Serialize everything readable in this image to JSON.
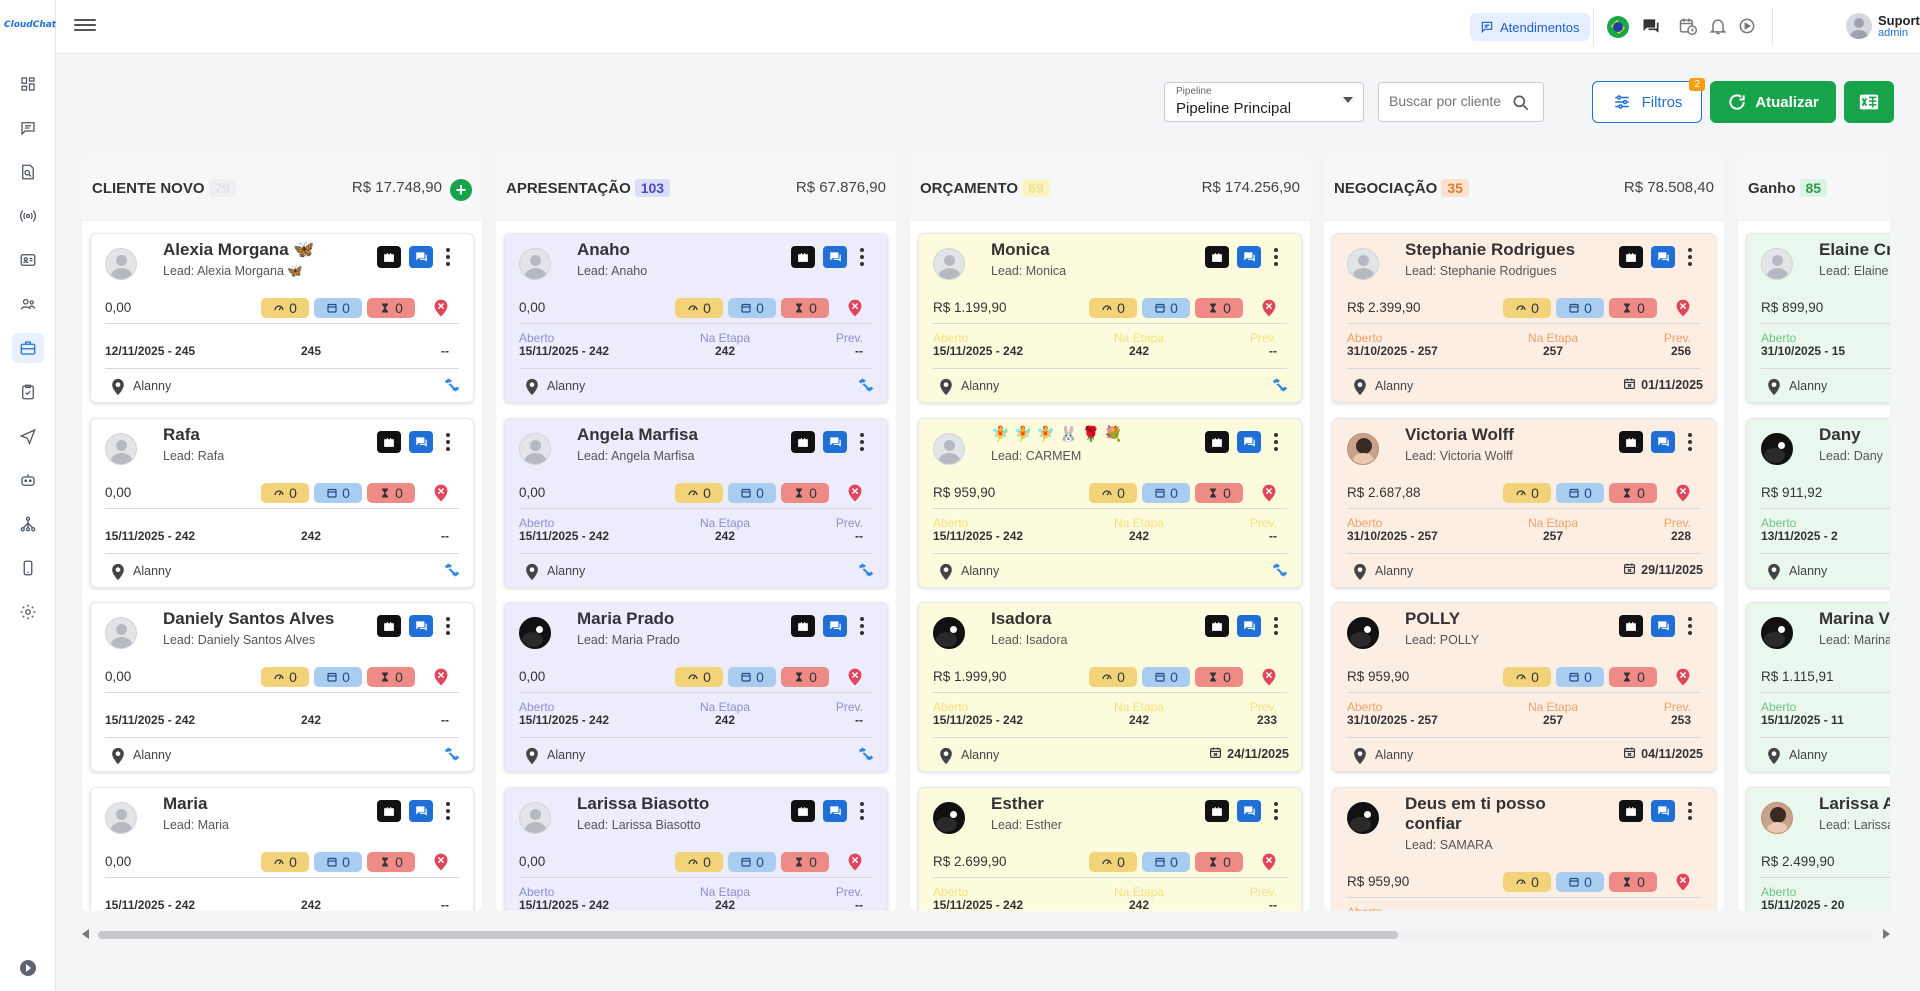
{
  "app": {
    "logo_text": "CloudChat",
    "brand_color": "#1f6fd6"
  },
  "sidebar": {
    "items": [
      {
        "icon": "dashboard-icon"
      },
      {
        "icon": "chat-icon"
      },
      {
        "icon": "search-doc-icon"
      },
      {
        "icon": "broadcast-icon"
      },
      {
        "icon": "contact-card-icon"
      },
      {
        "icon": "users-icon"
      },
      {
        "icon": "briefcase-icon",
        "active": true
      },
      {
        "icon": "task-icon"
      },
      {
        "icon": "send-icon"
      },
      {
        "icon": "bot-icon"
      },
      {
        "icon": "flow-icon"
      },
      {
        "icon": "phone-icon"
      },
      {
        "icon": "settings-icon"
      }
    ]
  },
  "topbar": {
    "atendimentos_label": "Atendimentos",
    "user_name": "Suporte",
    "user_role": "admin"
  },
  "toolbar": {
    "pipeline_label": "Pipeline",
    "pipeline_value": "Pipeline Principal",
    "search_placeholder": "Buscar por cliente",
    "filtros_label": "Filtros",
    "filtros_badge": "2",
    "atualizar_label": "Atualizar"
  },
  "columns": [
    {
      "title": "CLIENTE NOVO",
      "count": "79",
      "count_bg": "#eef0f2",
      "count_color": "#dfe2e6",
      "total": "R$ 17.748,90",
      "bg": "#ffffff",
      "add": true,
      "cards": [
        {
          "name": "Alexia Morgana 🦋",
          "lead": "Lead: Alexia Morgana 🦋",
          "value": "0,00",
          "labels": false,
          "d1": "12/11/2025 - 245",
          "d2": "245",
          "d3": "--",
          "user": "Alanny",
          "right": "handshake",
          "avatar": "default"
        },
        {
          "name": "Rafa",
          "lead": "Lead: Rafa",
          "value": "0,00",
          "labels": false,
          "d1": "15/11/2025 - 242",
          "d2": "242",
          "d3": "--",
          "user": "Alanny",
          "right": "handshake",
          "avatar": "default"
        },
        {
          "name": "Daniely Santos Alves",
          "lead": "Lead: Daniely Santos Alves",
          "value": "0,00",
          "labels": false,
          "d1": "15/11/2025 - 242",
          "d2": "242",
          "d3": "--",
          "user": "Alanny",
          "right": "handshake",
          "avatar": "default"
        },
        {
          "name": "Maria",
          "lead": "Lead: Maria",
          "value": "0,00",
          "labels": false,
          "d1": "15/11/2025 - 242",
          "d2": "242",
          "d3": "--",
          "user": "",
          "right": "",
          "avatar": "default"
        }
      ]
    },
    {
      "title": "APRESENTAÇÃO",
      "count": "103",
      "count_bg": "#dcdcfb",
      "count_color": "#4b4bc4",
      "total": "R$ 67.876,90",
      "bg": "#ececfd",
      "add": false,
      "cards": [
        {
          "name": "Anaho",
          "lead": "Lead: Anaho",
          "value": "0,00",
          "labels": true,
          "d1": "15/11/2025 - 242",
          "d2": "242",
          "d3": "--",
          "user": "Alanny",
          "right": "handshake",
          "avatar": "default"
        },
        {
          "name": "Angela Marfisa",
          "lead": "Lead: Angela Marfisa",
          "value": "0,00",
          "labels": true,
          "d1": "15/11/2025 - 242",
          "d2": "242",
          "d3": "--",
          "user": "Alanny",
          "right": "handshake",
          "avatar": "default"
        },
        {
          "name": "Maria Prado",
          "lead": "Lead: Maria Prado",
          "value": "0,00",
          "labels": true,
          "d1": "15/11/2025 - 242",
          "d2": "242",
          "d3": "--",
          "user": "Alanny",
          "right": "handshake",
          "avatar": "dark"
        },
        {
          "name": "Larissa Biasotto",
          "lead": "Lead: Larissa Biasotto",
          "value": "0,00",
          "labels": true,
          "d1": "15/11/2025 - 242",
          "d2": "242",
          "d3": "--",
          "user": "",
          "right": "",
          "avatar": "default"
        }
      ]
    },
    {
      "title": "ORÇAMENTO",
      "count": "69",
      "count_bg": "#fbf5c6",
      "count_color": "#efe48a",
      "total": "R$ 174.256,90",
      "bg": "#fdfbdd",
      "add": false,
      "cards": [
        {
          "name": "Monica",
          "lead": "Lead: Monica",
          "value": "R$ 1.199,90",
          "labels": true,
          "d1": "15/11/2025 - 242",
          "d2": "242",
          "d3": "--",
          "user": "Alanny",
          "right": "handshake",
          "avatar": "default"
        },
        {
          "name": "",
          "emojis": "🧚🧚🧚🐰🌹💐",
          "lead": "Lead: CARMEM",
          "value": "R$ 959,90",
          "labels": true,
          "d1": "15/11/2025 - 242",
          "d2": "242",
          "d3": "--",
          "user": "Alanny",
          "right": "handshake",
          "avatar": "default"
        },
        {
          "name": "Isadora",
          "lead": "Lead: Isadora",
          "value": "R$ 1.999,90",
          "labels": true,
          "d1": "15/11/2025 - 242",
          "d2": "242",
          "d3": "233",
          "user": "Alanny",
          "right": "24/11/2025",
          "avatar": "dark"
        },
        {
          "name": "Esther",
          "lead": "Lead: Esther",
          "value": "R$ 2.699,90",
          "labels": true,
          "d1": "15/11/2025 - 242",
          "d2": "242",
          "d3": "--",
          "user": "",
          "right": "",
          "avatar": "dark"
        }
      ]
    },
    {
      "title": "NEGOCIAÇÃO",
      "count": "35",
      "count_bg": "#fde3cf",
      "count_color": "#e07b2a",
      "total": "R$ 78.508,40",
      "bg": "#fdeee4",
      "add": false,
      "cards": [
        {
          "name": "Stephanie Rodrigues",
          "lead": "Lead: Stephanie Rodrigues",
          "value": "R$ 2.399,90",
          "labels": true,
          "d1": "31/10/2025 - 257",
          "d2": "257",
          "d3": "256",
          "user": "Alanny",
          "right": "01/11/2025",
          "avatar": "default"
        },
        {
          "name": "Victoria Wolff",
          "lead": "Lead: Victoria Wolff",
          "value": "R$ 2.687,88",
          "labels": true,
          "d1": "31/10/2025 - 257",
          "d2": "257",
          "d3": "228",
          "user": "Alanny",
          "right": "29/11/2025",
          "avatar": "photo"
        },
        {
          "name": "POLLY",
          "lead": "Lead: POLLY",
          "value": "R$ 959,90",
          "labels": true,
          "d1": "31/10/2025 - 257",
          "d2": "257",
          "d3": "253",
          "user": "Alanny",
          "right": "04/11/2025",
          "avatar": "dark"
        },
        {
          "name": "Deus em ti posso confiar",
          "lead": "Lead: SAMARA",
          "value": "R$ 959,90",
          "labels": true,
          "d1": "",
          "d2": "",
          "d3": "",
          "user": "",
          "right": "",
          "avatar": "dark",
          "tall": true
        }
      ]
    },
    {
      "title": "Ganho",
      "count": "85",
      "count_bg": "#dcf3e2",
      "count_color": "#2e9b4f",
      "total": "",
      "bg": "#e9f7ec",
      "add": false,
      "cards": [
        {
          "name": "Elaine Cri",
          "lead": "Lead: Elaine C",
          "value": "R$ 899,90",
          "labels": true,
          "d1": "31/10/2025 - 15",
          "d2": "",
          "d3": "",
          "user": "Alanny",
          "right": "",
          "avatar": "default"
        },
        {
          "name": "Dany",
          "lead": "Lead: Dany",
          "value": "R$ 911,92",
          "labels": true,
          "d1": "13/11/2025 - 2",
          "d2": "",
          "d3": "",
          "user": "Alanny",
          "right": "",
          "avatar": "dark"
        },
        {
          "name": "Marina Vi",
          "lead": "Lead: Marina",
          "value": "R$ 1.115,91",
          "labels": true,
          "d1": "15/11/2025 - 11",
          "d2": "",
          "d3": "",
          "user": "Alanny",
          "right": "",
          "avatar": "dark"
        },
        {
          "name": "Larissa A",
          "lead": "Lead: Larissa",
          "value": "R$ 2.499,90",
          "labels": true,
          "d1": "15/11/2025 - 20",
          "d2": "",
          "d3": "",
          "user": "",
          "right": "",
          "avatar": "photo"
        }
      ]
    }
  ],
  "card_labels": {
    "aberto": "Aberto",
    "na_etapa": "Na Etapa",
    "prev": "Prev."
  },
  "chips": {
    "a": "0",
    "b": "0",
    "c": "0"
  }
}
